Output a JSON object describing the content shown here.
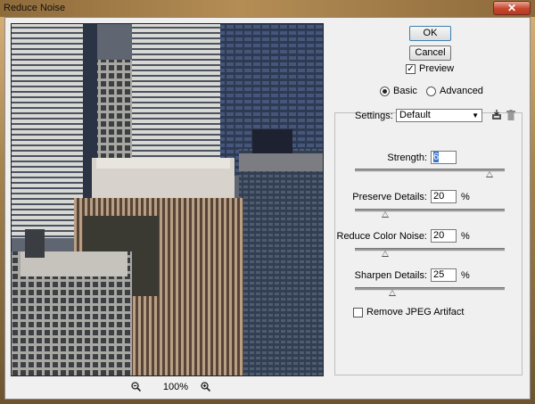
{
  "window": {
    "title": "Reduce Noise",
    "close_glyph": "✕"
  },
  "buttons": {
    "ok": "OK",
    "cancel": "Cancel"
  },
  "preview_toggle": {
    "label": "Preview",
    "checked": true
  },
  "mode": {
    "options": [
      "Basic",
      "Advanced"
    ],
    "selected": "Basic"
  },
  "settings": {
    "label": "Settings:",
    "value": "Default",
    "save_icon": "save-preset-icon",
    "delete_icon": "trash-icon"
  },
  "params": [
    {
      "label": "Strength:",
      "value": "6",
      "unit": "",
      "max": 10,
      "focused": true
    },
    {
      "label": "Preserve Details:",
      "value": "20",
      "unit": "%",
      "max": 100
    },
    {
      "label": "Reduce Color Noise:",
      "value": "20",
      "unit": "%",
      "max": 100
    },
    {
      "label": "Sharpen Details:",
      "value": "25",
      "unit": "%",
      "max": 100
    }
  ],
  "jpeg_artifact": {
    "label": "Remove JPEG Artifact",
    "checked": false
  },
  "zoom": {
    "level": "100%",
    "zoom_out_icon": "zoom-out-icon",
    "zoom_in_icon": "zoom-in-icon"
  }
}
